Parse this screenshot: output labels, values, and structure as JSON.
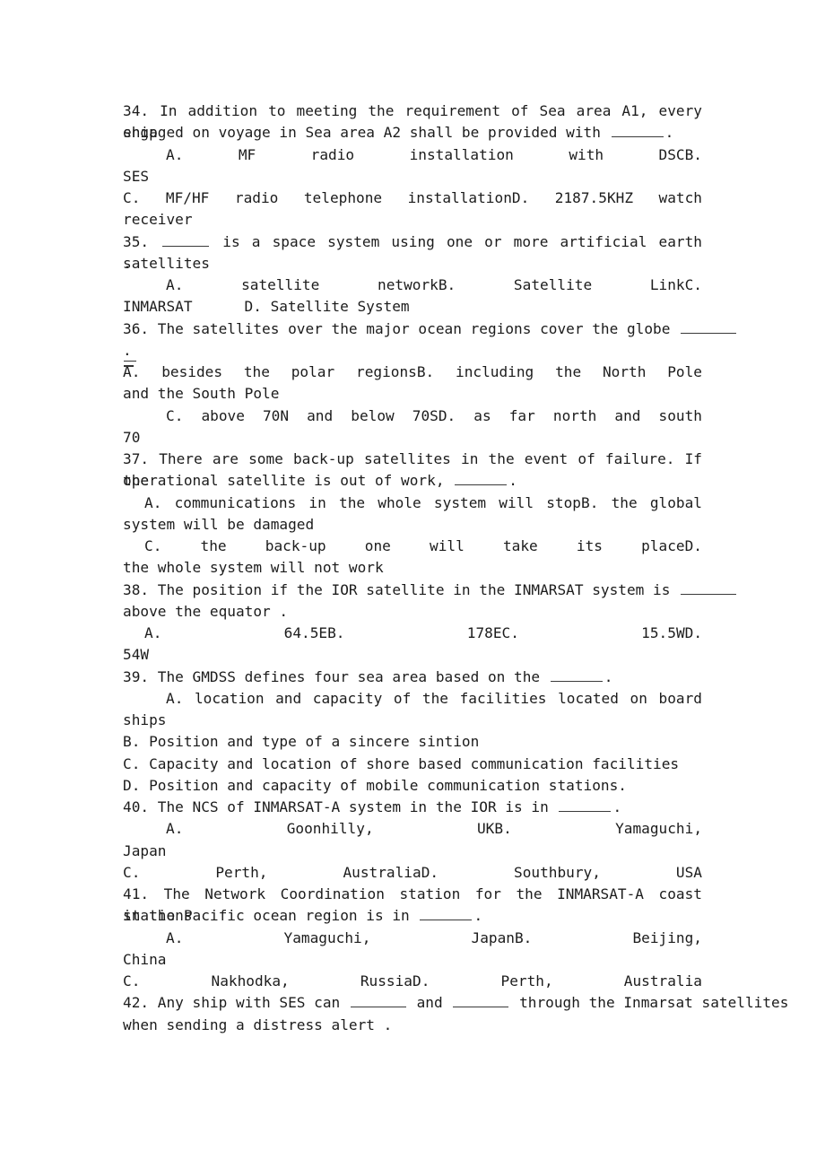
{
  "document": {
    "type": "exam-question-sheet",
    "subject": "GMDSS / INMARSAT maritime communications",
    "page_background": "#ffffff",
    "text_color": "#1c1c1c",
    "questions": [
      {
        "number": "34.",
        "stem_lines": [
          "34. In addition to meeting the requirement of Sea area A1, every ship",
          "engaged on voyage in Sea area A2 shall be provided with"
        ],
        "stem_tail": ".",
        "option_lines": [
          "A. MF radio installation with DSC",
          "B.",
          "SES",
          "C. MF/HF radio telephone installation",
          "D. 2187.5KHZ watch",
          "receiver"
        ]
      },
      {
        "number": "35.",
        "stem_lines": [
          "35.",
          "is a space system using one or more artificial earth satellites",
          "."
        ],
        "option_lines": [
          "A. satellite network",
          "B. Satellite Link",
          "C.",
          "INMARSAT",
          "D. Satellite System"
        ]
      },
      {
        "number": "36.",
        "stem_lines": [
          "36. The satellites over the major ocean regions cover the globe",
          "."
        ],
        "option_lines": [
          "A. besides the polar regions",
          "B. including the North Pole",
          "and the South Pole",
          "C. above 70N and below 70S",
          "D. as far north and south",
          "70"
        ]
      },
      {
        "number": "37.",
        "stem_lines": [
          "37. There are some back-up satellites in the event of failure. If the",
          "operational satellite is out of work,",
          "."
        ],
        "option_lines": [
          "A. communications in the whole system will stop",
          "B. the global",
          "system will be damaged",
          "C. the back-up one will take its place",
          "D.",
          "the whole system will not work"
        ]
      },
      {
        "number": "38.",
        "stem_lines": [
          "38. The position if the IOR satellite in the INMARSAT system is",
          "above the equator ."
        ],
        "option_lines": [
          "A. 64.5E",
          "B. 178E",
          "C. 15.5W",
          "D.",
          "54W"
        ]
      },
      {
        "number": "39.",
        "stem_lines": [
          "39. The GMDSS defines four sea area based on the",
          "."
        ],
        "option_lines": [
          "A. location and capacity of the facilities located on board",
          "ships",
          "B. Position and type of a sincere sintion",
          "C. Capacity and location of shore based communication facilities",
          "D. Position and capacity of mobile communication stations."
        ]
      },
      {
        "number": "40.",
        "stem_lines": [
          "40. The NCS of INMARSAT-A system in the IOR is in",
          "."
        ],
        "option_lines": [
          "A. Goonhilly, UK",
          "B. Yamaguchi,",
          "Japan",
          "C. Perth, Australia",
          "D. Southbury, USA"
        ]
      },
      {
        "number": "41.",
        "stem_lines": [
          "41. The Network Coordination station for the INMARSAT-A coast stations",
          "in the Pacific ocean region is in",
          "."
        ],
        "option_lines": [
          "A. Yamaguchi, Japan",
          "B. Beijing,",
          "China",
          "C. Nakhodka, Russia",
          "D. Perth, Australia"
        ]
      },
      {
        "number": "42.",
        "stem_lines": [
          "42. Any ship with SES can",
          "and",
          "through the Inmarsat satellites",
          "when sending a distress alert ."
        ],
        "option_lines": []
      }
    ]
  },
  "lines": {
    "l01_a": "34. In addition to meeting the requirement of Sea area A1, every ship",
    "l02_a": "engaged on voyage in Sea area A2 shall be provided with ",
    "l02_b": ".",
    "l03_a": "A. MF radio installation with DSC",
    "l03_b": "B.",
    "l04_a": "SES",
    "l05_a": "C. MF/HF radio telephone installation",
    "l05_b": "D. 2187.5KHZ watch",
    "l06_a": "receiver",
    "l07_a": "35. ",
    "l07_b": " is a space system using one or more artificial earth satellites",
    "l08_a": ".",
    "l09_a": "A. satellite network",
    "l09_b": "B. Satellite Link",
    "l09_c": "C.",
    "l10_a": "INMARSAT",
    "l10_b": "D. Satellite System",
    "l11_a": "36. The satellites over the major ocean regions cover the globe ",
    "l12_a": ".",
    "l13_a": "A. besides the polar regions",
    "l13_b": "B. including the North Pole",
    "l14_a": "and the South Pole",
    "l15_a": "C. above 70N and below 70S",
    "l15_b": "D. as far north and south",
    "l16_a": "70",
    "l17_a": "37. There are some back-up satellites in the event of failure. If the",
    "l18_a": "operational satellite is out of work, ",
    "l18_b": ".",
    "l19_a": "A. communications in the whole system will stop",
    "l19_b": "B. the global",
    "l20_a": "system will be damaged",
    "l21_a": "C. the back-up one will take its place",
    "l21_b": "D.",
    "l22_a": "the whole system will not work",
    "l23_a": "38. The position if the IOR satellite in the INMARSAT system is ",
    "l24_a": "above the equator .",
    "l25_a": "A. 64.5E",
    "l25_b": "B. 178E",
    "l25_c": "C. 15.5W",
    "l25_d": "D.",
    "l26_a": "54W",
    "l27_a": "39. The GMDSS defines four sea area based on the ",
    "l27_b": ".",
    "l28_a": "A. location and capacity of the facilities located on board",
    "l29_a": "ships",
    "l30_a": "B. Position and type of a sincere sintion",
    "l31_a": "C. Capacity and location of shore based communication facilities",
    "l32_a": "D. Position and capacity of mobile communication stations.",
    "l33_a": "40. The NCS of INMARSAT-A system in the IOR is in ",
    "l33_b": ".",
    "l34_a": "A. Goonhilly, UK",
    "l34_b": "B. Yamaguchi,",
    "l35_a": "Japan",
    "l36_a": "C. Perth, Australia",
    "l36_b": "D. Southbury, USA",
    "l37_a": "41. The Network Coordination station for the INMARSAT-A coast stations",
    "l38_a": "in the Pacific ocean region is in ",
    "l38_b": ".",
    "l39_a": "A. Yamaguchi, Japan",
    "l39_b": "B. Beijing,",
    "l40_a": "China",
    "l41_a": "C. Nakhodka, Russia",
    "l41_b": "D. Perth, Australia",
    "l42_a": "42. Any ship with SES can ",
    "l42_b": " and ",
    "l42_c": " through the Inmarsat satellites",
    "l43_a": "when sending a distress alert ."
  }
}
